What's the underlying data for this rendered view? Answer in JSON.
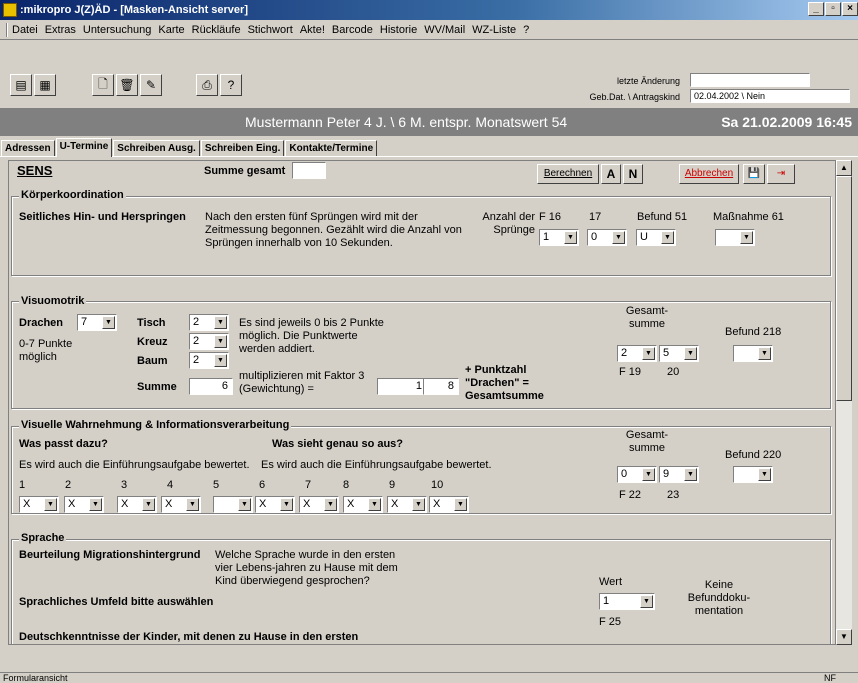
{
  "window": {
    "title": ":mikropro J(Z)ÄD - [Masken-Ansicht server]",
    "controls": [
      "_",
      "▫",
      "×"
    ]
  },
  "menu": [
    "Datei",
    "Extras",
    "Untersuchung",
    "Karte",
    "Rückläufe",
    "Stichwort",
    "Akte!",
    "Barcode",
    "Historie",
    "WV/Mail",
    "WZ-Liste",
    "?"
  ],
  "toolbar": {
    "last_change_label": "letzte Änderung",
    "last_change_value": "",
    "geb_label": "Geb.Dat. \\ Antragskind",
    "geb_value": "02.04.2002 \\ Nein"
  },
  "patient": {
    "name": "Mustermann Peter 4 J. \\ 6 M. entspr. Monatswert 54",
    "date": "Sa 21.02.2009 16:45"
  },
  "tabs": [
    "Adressen",
    "U-Termine",
    "Schreiben Ausg.",
    "Schreiben Eing.",
    "Kontakte/Termine"
  ],
  "header": {
    "title": "SENS",
    "sum_label": "Summe gesamt",
    "sum_value": "",
    "calc": "Berechnen",
    "a": "A",
    "n": "N",
    "cancel": "Abbrechen"
  },
  "koerper": {
    "title": "Körperkoordination",
    "label": "Seitliches Hin- und Herspringen",
    "desc": "Nach den ersten fünf Sprüngen wird mit der Zeitmessung begonnen. Gezählt wird die Anzahl von Sprüngen innerhalb von 10 Sekunden.",
    "count_label": "Anzahl der Sprünge",
    "f16": "F 16",
    "f17": "17",
    "befund": "Befund 51",
    "massnahme": "Maßnahme 61",
    "v1": "1",
    "v2": "0",
    "v3": "U",
    "v4": ""
  },
  "visuo": {
    "title": "Visuomotrik",
    "drachen": "Drachen",
    "drachen_val": "7",
    "punkte": "0-7 Punkte möglich",
    "tisch": "Tisch",
    "kreuz": "Kreuz",
    "baum": "Baum",
    "summe": "Summe",
    "tisch_val": "2",
    "kreuz_val": "2",
    "baum_val": "2",
    "summe_val": "6",
    "desc1": "Es sind jeweils 0 bis 2 Punkte möglich. Die Punktwerte werden addiert.",
    "desc2": "multiplizieren mit Faktor 3 (Gewichtung) =",
    "factor": "1",
    "result": "8",
    "plus": "+ Punktzahl \"Drachen\" = Gesamtsumme",
    "gesamt": "Gesamt-summe",
    "g1": "2",
    "g2": "5",
    "f19": "F 19",
    "f20": "20",
    "befund": "Befund 218",
    "bval": ""
  },
  "visuell": {
    "title": "Visuelle Wahrnehmung & Informationsverarbeitung",
    "q1": "Was passt dazu?",
    "q2": "Was sieht genau so aus?",
    "n1": "Es wird auch die Einführungsaufgabe bewertet.",
    "n2": "Es wird auch die Einführungsaufgabe bewertet.",
    "nums": [
      "1",
      "2",
      "3",
      "4",
      "5",
      "6",
      "7",
      "8",
      "9",
      "10"
    ],
    "vals": [
      "X",
      "X",
      "X",
      "X",
      "",
      "X",
      "X",
      "X",
      "X",
      "X"
    ],
    "gesamt": "Gesamt-summe",
    "g1": "0",
    "g2": "9",
    "f22": "F 22",
    "f23": "23",
    "befund": "Befund 220",
    "bval": ""
  },
  "sprache": {
    "title": "Sprache",
    "label1": "Beurteilung Migrationshintergrund",
    "q": "Welche Sprache wurde in den ersten vier Lebens-jahren zu Hause mit dem Kind überwiegend gesprochen?",
    "label2": "Sprachliches Umfeld bitte auswählen",
    "wert": "Wert",
    "wert_val": "1",
    "f25": "F 25",
    "keine": "Keine Befunddoku-mentation",
    "label3": "Deutschkenntnisse der Kinder, mit denen zu Hause in den ersten"
  },
  "status": {
    "text": "Formularansicht",
    "nf": "NF"
  }
}
